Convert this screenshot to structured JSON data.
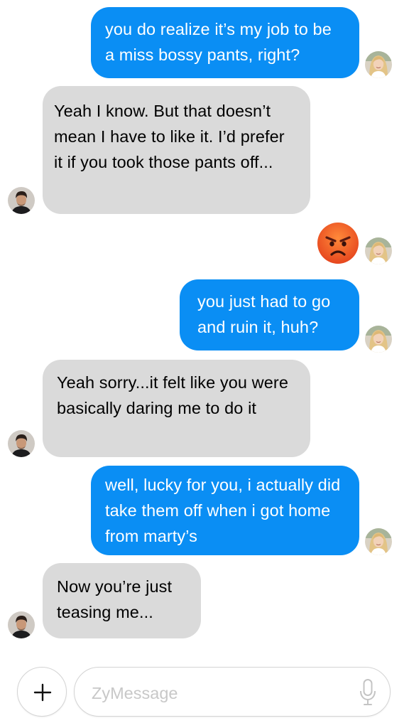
{
  "messages": [
    {
      "sender": "me",
      "text": "you do realize it’s my job to be a miss bossy pants, right?"
    },
    {
      "sender": "them",
      "text": "Yeah I know. But that doesn’t mean I have to like it. I’d prefer it if you took those pants off..."
    },
    {
      "sender": "me",
      "type": "emoji",
      "emoji": "angry-face"
    },
    {
      "sender": "me",
      "text": "you just had to go and ruin it, huh?"
    },
    {
      "sender": "them",
      "text": "Yeah sorry...it felt like you were basically daring me to do it"
    },
    {
      "sender": "me",
      "text": "well, lucky for you, i actually did take them off when i got home from marty’s"
    },
    {
      "sender": "them",
      "text": "Now you’re just teasing me..."
    }
  ],
  "composer": {
    "placeholder": "ZyMessage",
    "add_icon": "plus-icon",
    "mic_icon": "microphone-icon"
  },
  "colors": {
    "outgoing_bubble": "#0a8ef4",
    "incoming_bubble": "#dadada",
    "emoji_face": "#f0622a"
  }
}
